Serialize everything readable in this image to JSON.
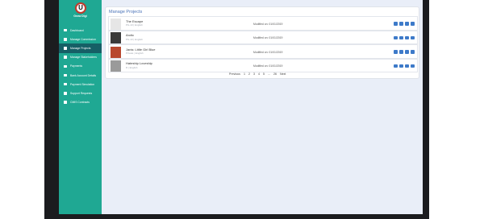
{
  "sidebar": {
    "brand": "Grow Digi",
    "logo_letter": "U",
    "items": [
      {
        "label": "Dashboard"
      },
      {
        "label": "Manage Commission"
      },
      {
        "label": "Manage Projects"
      },
      {
        "label": "Manage Stakeholders"
      },
      {
        "label": "Payments"
      },
      {
        "label": "Bank Account Details"
      },
      {
        "label": "Payment Simulation"
      },
      {
        "label": "Support Requests"
      },
      {
        "label": "CMIS Contracts"
      }
    ],
    "active_index": 2
  },
  "main": {
    "title": "Manage Projects",
    "projects": [
      {
        "title": "The Escape",
        "meta": "PG-13 | English",
        "modified": "Modified on: 01/01/2019"
      },
      {
        "title": "Arctic",
        "meta": "PG-13 | English",
        "modified": "Modified on: 01/01/2019"
      },
      {
        "title": "Janis: Little Girl Blue",
        "meta": "Private | English",
        "modified": "Modified on: 01/01/2019"
      },
      {
        "title": "Hateship Loveship",
        "meta": "R | English",
        "modified": "Modified on: 01/01/2019"
      }
    ],
    "pagination": {
      "previous": "Previous",
      "pages": [
        "1",
        "2",
        "3",
        "4",
        "5",
        "...",
        "26"
      ],
      "next": "Next"
    }
  },
  "colors": {
    "sidebar": "#1fa893",
    "sidebar_active": "#165f66",
    "accent": "#3d7ac9",
    "page_bg": "#e9eef8"
  }
}
